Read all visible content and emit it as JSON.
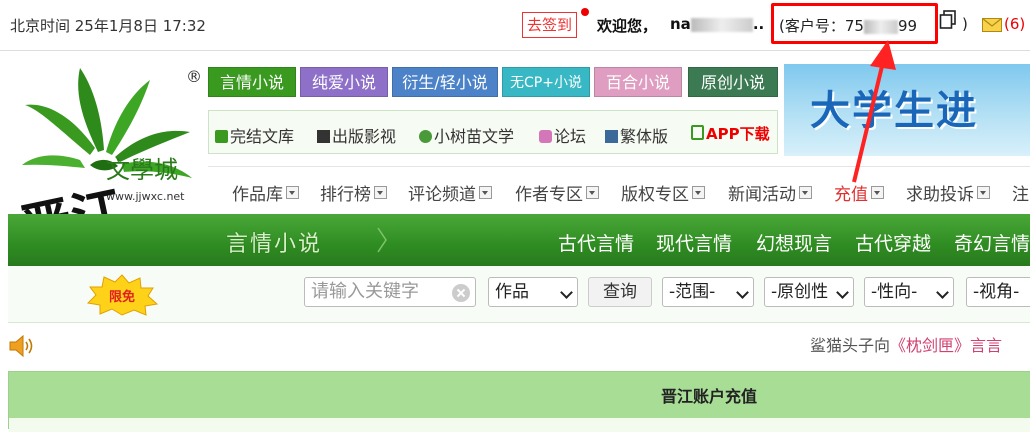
{
  "topbar": {
    "beijing_time": "北京时间  25年1月8日  17:32",
    "checkin_label": "去签到",
    "welcome": "欢迎您，",
    "username_prefix": "na",
    "username_suffix": "..",
    "customer_prefix": "(客户号：75",
    "customer_suffix": "99",
    "paren_close": ")",
    "mail_count": "(6)"
  },
  "categories": [
    "言情小说",
    "纯爱小说",
    "衍生/轻小说",
    "无CP+小说",
    "百合小说",
    "原创小说"
  ],
  "banner_text": "大学生进",
  "sublinks": [
    "完结文库",
    "出版影视",
    "小树苗文学",
    "论坛",
    "繁体版",
    "APP下载"
  ],
  "nav": [
    "作品库",
    "排行榜",
    "评论频道",
    "作者专区",
    "版权专区",
    "新闻活动",
    "充值",
    "求助投诉",
    "注"
  ],
  "section": {
    "title": "言情小说",
    "links": [
      "古代言情",
      "现代言情",
      "幻想现言",
      "古代穿越",
      "奇幻言情"
    ]
  },
  "search": {
    "badge": "限免",
    "placeholder": "请输入关键字",
    "type_value": "作品",
    "query_label": "查询",
    "filters": [
      "-范围-",
      "-原创性",
      "-性向-",
      "-视角-"
    ]
  },
  "ticker": {
    "prefix": "鲨猫头子向",
    "book": "《枕剑匣》",
    "suffix": "言言"
  },
  "recharge_title": "晋江账户充值",
  "logo": {
    "site_name": "文學城",
    "url": "www.jjwxc.net",
    "calligraphy": "晋江",
    "registered": "®"
  },
  "colors": {
    "accent_green": "#2f8c22",
    "highlight_red": "#ff0000"
  }
}
